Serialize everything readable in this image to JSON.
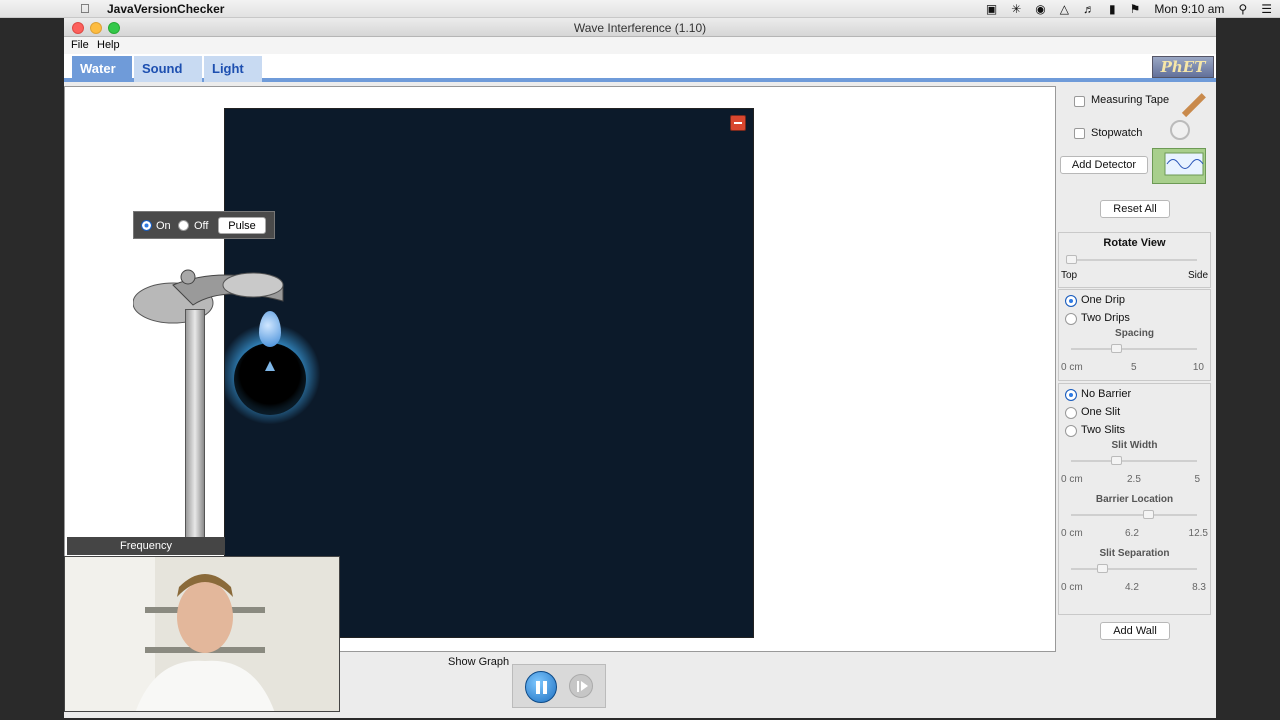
{
  "menubar": {
    "app_name": "JavaVersionChecker",
    "clock": "Mon 9:10 am"
  },
  "window": {
    "title": "Wave Interference (1.10)",
    "menu": {
      "file": "File",
      "help": "Help"
    },
    "tabs": [
      {
        "label": "Water",
        "active": true
      },
      {
        "label": "Sound",
        "active": false
      },
      {
        "label": "Light",
        "active": false
      }
    ],
    "logo": "PhET"
  },
  "faucet": {
    "on_label": "On",
    "off_label": "Off",
    "pulse_label": "Pulse",
    "mode": "On"
  },
  "frequency_label": "Frequency",
  "bottom": {
    "show_graph": "Show Graph"
  },
  "controls": {
    "measuring_tape": "Measuring Tape",
    "stopwatch": "Stopwatch",
    "add_detector": "Add Detector",
    "reset_all": "Reset All",
    "rotate_view": {
      "title": "Rotate View",
      "min_label": "Top",
      "max_label": "Side",
      "value": 0
    },
    "drips": {
      "options": [
        "One Drip",
        "Two Drips"
      ],
      "selected": "One Drip",
      "spacing": {
        "title": "Spacing",
        "min": "0 cm",
        "mid": "5",
        "max": "10",
        "value": 0.35
      }
    },
    "barrier": {
      "options": [
        "No Barrier",
        "One Slit",
        "Two Slits"
      ],
      "selected": "No Barrier",
      "slit_width": {
        "title": "Slit Width",
        "min": "0 cm",
        "mid": "2.5",
        "max": "5",
        "value": 0.35
      },
      "barrier_location": {
        "title": "Barrier Location",
        "min": "0 cm",
        "mid": "6.2",
        "max": "12.5",
        "value": 0.6
      },
      "slit_separation": {
        "title": "Slit Separation",
        "min": "0 cm",
        "mid": "4.2",
        "max": "8.3",
        "value": 0.25
      }
    },
    "add_wall": "Add Wall"
  },
  "colors": {
    "tab_active": "#6f9bd9",
    "water_light": "#3a9ee0",
    "water_dark": "#0c1a2a",
    "radio_selected": "#2f7be4"
  }
}
